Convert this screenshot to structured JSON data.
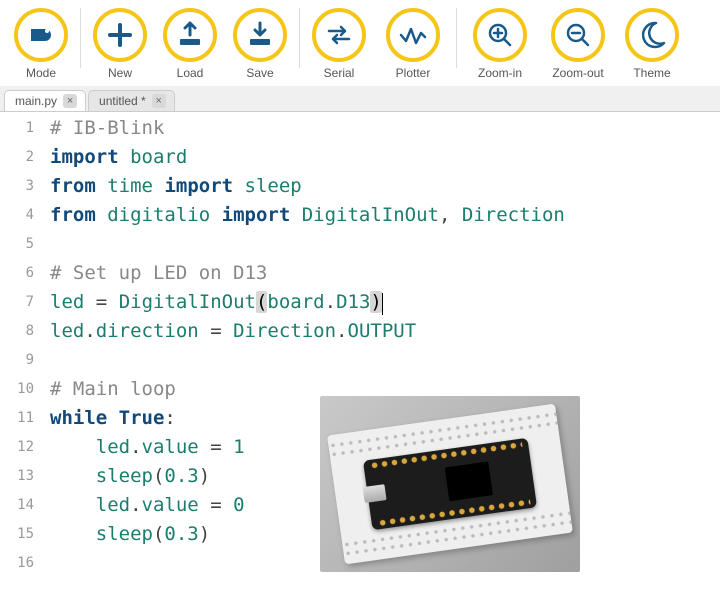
{
  "toolbar": {
    "groups": [
      {
        "items": [
          {
            "id": "mode",
            "label": "Mode",
            "icon": "mode-icon"
          }
        ]
      },
      {
        "items": [
          {
            "id": "new",
            "label": "New",
            "icon": "plus-icon"
          },
          {
            "id": "load",
            "label": "Load",
            "icon": "load-icon"
          },
          {
            "id": "save",
            "label": "Save",
            "icon": "save-icon"
          }
        ]
      },
      {
        "items": [
          {
            "id": "serial",
            "label": "Serial",
            "icon": "serial-icon"
          },
          {
            "id": "plotter",
            "label": "Plotter",
            "icon": "plotter-icon"
          }
        ]
      },
      {
        "items": [
          {
            "id": "zoom-in",
            "label": "Zoom-in",
            "icon": "zoom-in-icon"
          },
          {
            "id": "zoom-out",
            "label": "Zoom-out",
            "icon": "zoom-out-icon"
          },
          {
            "id": "theme",
            "label": "Theme",
            "icon": "theme-icon"
          }
        ]
      }
    ]
  },
  "tabs": [
    {
      "label": "main.py",
      "dirty": false,
      "active": true
    },
    {
      "label": "untitled *",
      "dirty": true,
      "active": false
    }
  ],
  "code": {
    "lines": [
      {
        "n": 1,
        "tokens": [
          {
            "c": "cmt",
            "t": "# IB-Blink"
          }
        ]
      },
      {
        "n": 2,
        "tokens": [
          {
            "c": "kw",
            "t": "import"
          },
          {
            "c": "plain",
            "t": " "
          },
          {
            "c": "name",
            "t": "board"
          }
        ]
      },
      {
        "n": 3,
        "tokens": [
          {
            "c": "kw",
            "t": "from"
          },
          {
            "c": "plain",
            "t": " "
          },
          {
            "c": "name",
            "t": "time"
          },
          {
            "c": "plain",
            "t": " "
          },
          {
            "c": "kw",
            "t": "import"
          },
          {
            "c": "plain",
            "t": " "
          },
          {
            "c": "name",
            "t": "sleep"
          }
        ]
      },
      {
        "n": 4,
        "tokens": [
          {
            "c": "kw",
            "t": "from"
          },
          {
            "c": "plain",
            "t": " "
          },
          {
            "c": "name",
            "t": "digitalio"
          },
          {
            "c": "plain",
            "t": " "
          },
          {
            "c": "kw",
            "t": "import"
          },
          {
            "c": "plain",
            "t": " "
          },
          {
            "c": "name",
            "t": "DigitalInOut"
          },
          {
            "c": "op",
            "t": ", "
          },
          {
            "c": "name",
            "t": "Direction"
          }
        ]
      },
      {
        "n": 5,
        "tokens": []
      },
      {
        "n": 6,
        "tokens": [
          {
            "c": "cmt",
            "t": "# Set up LED on D13"
          }
        ]
      },
      {
        "n": 7,
        "tokens": [
          {
            "c": "name",
            "t": "led"
          },
          {
            "c": "plain",
            "t": " "
          },
          {
            "c": "op",
            "t": "="
          },
          {
            "c": "plain",
            "t": " "
          },
          {
            "c": "name",
            "t": "DigitalInOut"
          },
          {
            "c": "paren-hl",
            "t": "("
          },
          {
            "c": "name",
            "t": "board"
          },
          {
            "c": "op",
            "t": "."
          },
          {
            "c": "name",
            "t": "D13"
          },
          {
            "c": "paren-hl",
            "t": ")"
          },
          {
            "c": "cursor",
            "t": ""
          }
        ]
      },
      {
        "n": 8,
        "tokens": [
          {
            "c": "name",
            "t": "led"
          },
          {
            "c": "op",
            "t": "."
          },
          {
            "c": "name",
            "t": "direction"
          },
          {
            "c": "plain",
            "t": " "
          },
          {
            "c": "op",
            "t": "="
          },
          {
            "c": "plain",
            "t": " "
          },
          {
            "c": "name",
            "t": "Direction"
          },
          {
            "c": "op",
            "t": "."
          },
          {
            "c": "name",
            "t": "OUTPUT"
          }
        ]
      },
      {
        "n": 9,
        "tokens": []
      },
      {
        "n": 10,
        "tokens": [
          {
            "c": "cmt",
            "t": "# Main loop"
          }
        ]
      },
      {
        "n": 11,
        "tokens": [
          {
            "c": "kw",
            "t": "while"
          },
          {
            "c": "plain",
            "t": " "
          },
          {
            "c": "kw",
            "t": "True"
          },
          {
            "c": "op",
            "t": ":"
          }
        ]
      },
      {
        "n": 12,
        "tokens": [
          {
            "c": "plain",
            "t": "    "
          },
          {
            "c": "name",
            "t": "led"
          },
          {
            "c": "op",
            "t": "."
          },
          {
            "c": "name",
            "t": "value"
          },
          {
            "c": "plain",
            "t": " "
          },
          {
            "c": "op",
            "t": "="
          },
          {
            "c": "plain",
            "t": " "
          },
          {
            "c": "num",
            "t": "1"
          }
        ]
      },
      {
        "n": 13,
        "tokens": [
          {
            "c": "plain",
            "t": "    "
          },
          {
            "c": "name",
            "t": "sleep"
          },
          {
            "c": "op",
            "t": "("
          },
          {
            "c": "num",
            "t": "0.3"
          },
          {
            "c": "op",
            "t": ")"
          }
        ]
      },
      {
        "n": 14,
        "tokens": [
          {
            "c": "plain",
            "t": "    "
          },
          {
            "c": "name",
            "t": "led"
          },
          {
            "c": "op",
            "t": "."
          },
          {
            "c": "name",
            "t": "value"
          },
          {
            "c": "plain",
            "t": " "
          },
          {
            "c": "op",
            "t": "="
          },
          {
            "c": "plain",
            "t": " "
          },
          {
            "c": "num",
            "t": "0"
          }
        ]
      },
      {
        "n": 15,
        "tokens": [
          {
            "c": "plain",
            "t": "    "
          },
          {
            "c": "name",
            "t": "sleep"
          },
          {
            "c": "op",
            "t": "("
          },
          {
            "c": "num",
            "t": "0.3"
          },
          {
            "c": "op",
            "t": ")"
          }
        ]
      },
      {
        "n": 16,
        "tokens": []
      }
    ]
  }
}
